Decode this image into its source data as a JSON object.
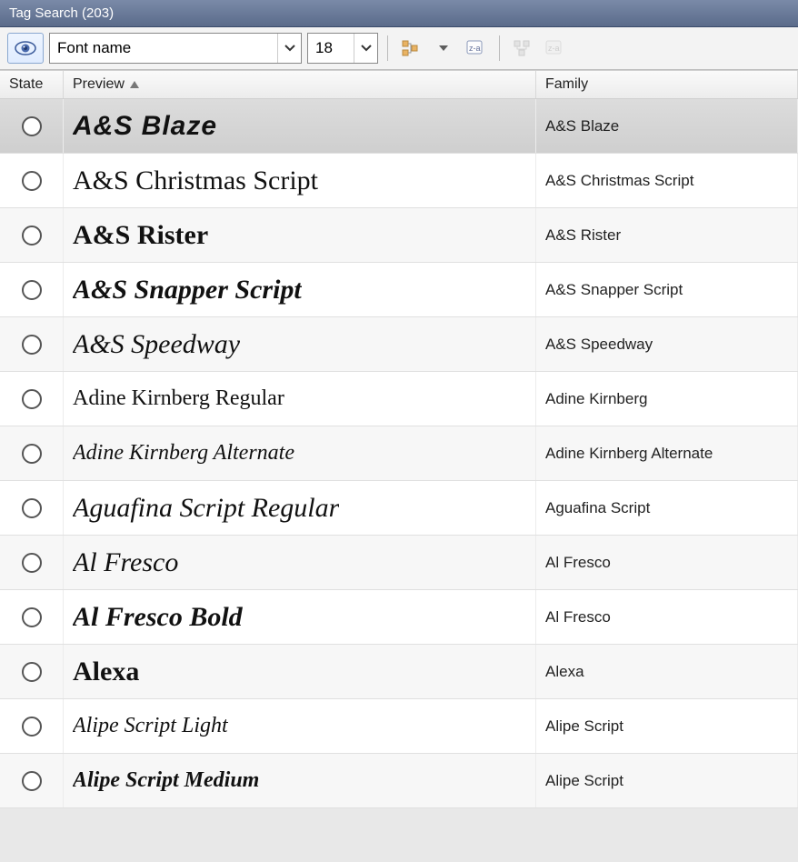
{
  "title": "Tag Search (203)",
  "toolbar": {
    "font_name_value": "Font name",
    "size_value": "18"
  },
  "columns": {
    "state": "State",
    "preview": "Preview",
    "family": "Family"
  },
  "rows": [
    {
      "preview": "A&S Blaze",
      "family": "A&S Blaze",
      "selected": true
    },
    {
      "preview": "A&S Christmas Script",
      "family": "A&S Christmas Script",
      "selected": false
    },
    {
      "preview": "A&S Rister",
      "family": "A&S Rister",
      "selected": false
    },
    {
      "preview": "A&S Snapper Script",
      "family": "A&S Snapper Script",
      "selected": false
    },
    {
      "preview": "A&S Speedway",
      "family": "A&S Speedway",
      "selected": false
    },
    {
      "preview": "Adine Kirnberg Regular",
      "family": "Adine Kirnberg",
      "selected": false
    },
    {
      "preview": "Adine Kirnberg Alternate",
      "family": "Adine Kirnberg Alternate",
      "selected": false
    },
    {
      "preview": "Aguafina Script Regular",
      "family": "Aguafina Script",
      "selected": false
    },
    {
      "preview": "Al Fresco",
      "family": "Al Fresco",
      "selected": false
    },
    {
      "preview": "Al Fresco Bold",
      "family": "Al Fresco",
      "selected": false
    },
    {
      "preview": "Alexa",
      "family": "Alexa",
      "selected": false
    },
    {
      "preview": "Alipe Script Light",
      "family": "Alipe Script",
      "selected": false
    },
    {
      "preview": "Alipe Script Medium",
      "family": "Alipe Script",
      "selected": false
    }
  ]
}
